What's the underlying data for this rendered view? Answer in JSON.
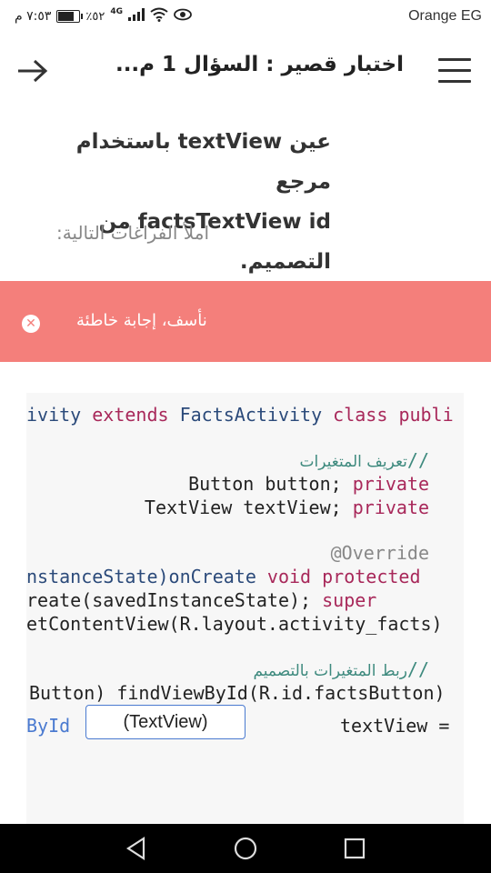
{
  "status_bar": {
    "time": "٧:٥٣ م",
    "battery_percent": "٥٢٪",
    "network": "4G",
    "carrier": "Orange EG"
  },
  "app_bar": {
    "title": "اختبار قصير : السؤال 1 م...",
    "back_icon": "arrow-right-icon",
    "menu_icon": "hamburger-menu-icon"
  },
  "question": {
    "line1": "عين textView باستخدام مرجع",
    "line2": "factsTextView id من التصميم."
  },
  "instruction": "املأ الفراغات التالية:",
  "feedback": {
    "message": "نأسف، إجابة خاطئة",
    "close_glyph": "✕",
    "color": "#f47f7b"
  },
  "code": {
    "line1_a": "ivity",
    "line1_b": " extends ",
    "line1_c": "FactsActivity",
    "line1_d": " class ",
    "line1_e": "publi",
    "comment1_slashes": "//",
    "comment1_text": " تعريف المتغيرات",
    "line3_code": "Button button; ",
    "line3_kw": "private",
    "line4_code": "TextView textView; ",
    "line4_kw": "private",
    "annotation": "@Override",
    "line6_a": "nstanceState)",
    "line6_b": "onCreate",
    "line6_c": " void",
    "line6_d": " protected",
    "line7_code": "reate(savedInstanceState); ",
    "line7_kw": "super",
    "line8_code": "etContentView(R.layout.activity_facts)",
    "comment2_text": "ربط المتغيرات بالتصميم",
    "comment2_slashes": "//",
    "line10_code": "Button) findViewById(R.id.factsButton)",
    "line11_left": "ById",
    "line11_right": "textView =",
    "blank_value": "(TextView)"
  }
}
